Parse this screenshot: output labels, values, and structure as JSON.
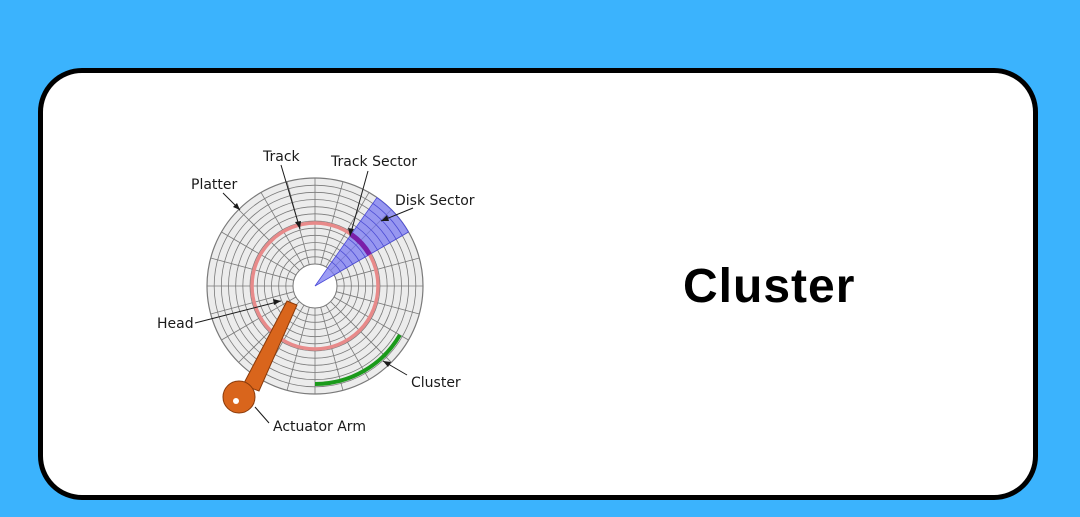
{
  "title": "Cluster",
  "labels": {
    "platter": "Platter",
    "track": "Track",
    "track_sector": "Track Sector",
    "disk_sector": "Disk Sector",
    "head": "Head",
    "cluster": "Cluster",
    "actuator_arm": "Actuator Arm"
  },
  "colors": {
    "background": "#3bb3fd",
    "card": "#ffffff",
    "platter_fill": "#ececec",
    "track_line": "#7a7a7a",
    "highlight_track": "#e88a8a",
    "disk_sector": "#7b7bf2",
    "track_sector": "#7a1fa8",
    "cluster": "#1a9a1a",
    "actuator_arm": "#d9651c"
  }
}
